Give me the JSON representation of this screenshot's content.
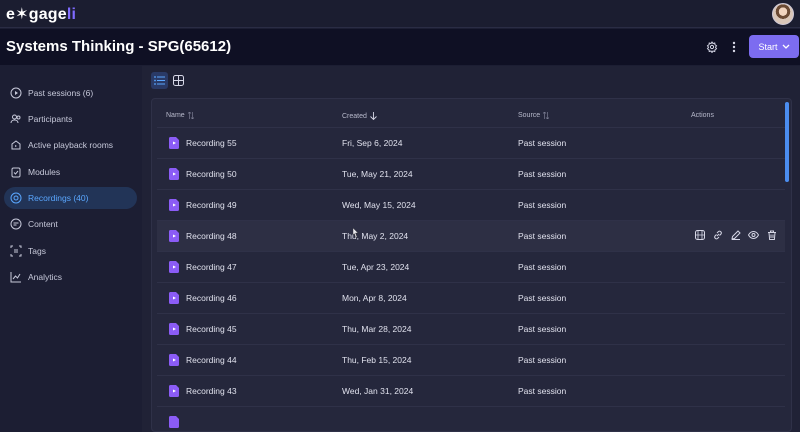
{
  "app": {
    "logo_left": "e",
    "logo_mid": "✶gage",
    "logo_right": "li"
  },
  "header": {
    "title": "Systems Thinking - SPG(65612)",
    "start_label": "Start"
  },
  "sidebar": {
    "items": [
      {
        "label": "Past sessions (6)",
        "icon": "play-circle-icon"
      },
      {
        "label": "Participants",
        "icon": "users-icon"
      },
      {
        "label": "Active playback rooms",
        "icon": "room-icon"
      },
      {
        "label": "Modules",
        "icon": "clipboard-icon"
      },
      {
        "label": "Recordings (40)",
        "icon": "recording-icon",
        "active": true
      },
      {
        "label": "Content",
        "icon": "content-icon"
      },
      {
        "label": "Tags",
        "icon": "tag-icon"
      },
      {
        "label": "Analytics",
        "icon": "chart-icon"
      }
    ]
  },
  "table": {
    "columns": {
      "name": "Name",
      "created": "Created",
      "source": "Source",
      "actions": "Actions"
    },
    "rows": [
      {
        "name": "Recording 55",
        "created": "Fri, Sep 6, 2024",
        "source": "Past session"
      },
      {
        "name": "Recording 50",
        "created": "Tue, May 21, 2024",
        "source": "Past session"
      },
      {
        "name": "Recording 49",
        "created": "Wed, May 15, 2024",
        "source": "Past session"
      },
      {
        "name": "Recording 48",
        "created": "Thu, May 2, 2024",
        "source": "Past session",
        "hover": true
      },
      {
        "name": "Recording 47",
        "created": "Tue, Apr 23, 2024",
        "source": "Past session"
      },
      {
        "name": "Recording 46",
        "created": "Mon, Apr 8, 2024",
        "source": "Past session"
      },
      {
        "name": "Recording 45",
        "created": "Thu, Mar 28, 2024",
        "source": "Past session"
      },
      {
        "name": "Recording 44",
        "created": "Thu, Feb 15, 2024",
        "source": "Past session"
      },
      {
        "name": "Recording 43",
        "created": "Wed, Jan 31, 2024",
        "source": "Past session"
      }
    ]
  },
  "colors": {
    "accent": "#7c6cf0",
    "active_nav": "#5aa7ff",
    "file_icon": "#8b5cf6"
  }
}
